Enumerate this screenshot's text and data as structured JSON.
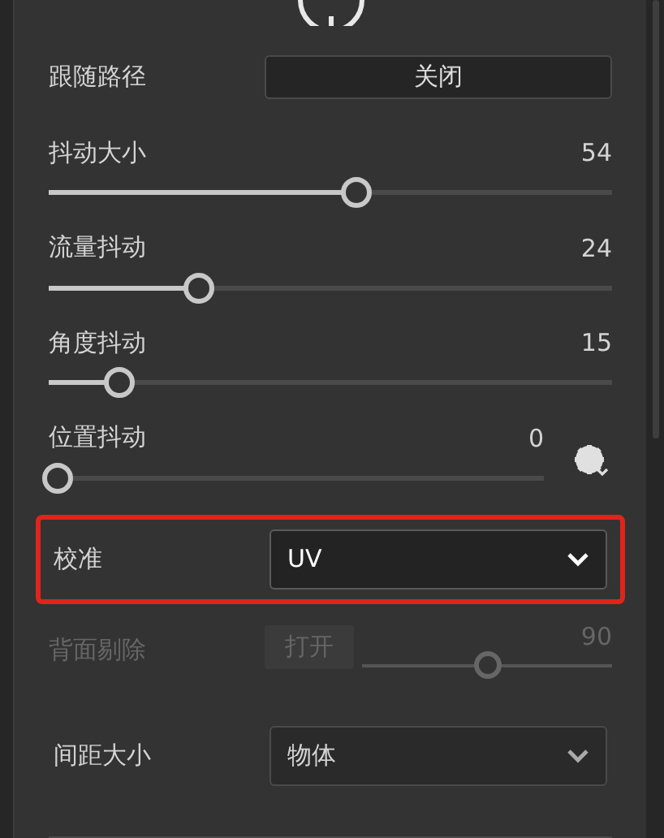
{
  "rows": [
    {
      "kind": "toggle",
      "label": "跟随路径",
      "button": "关闭"
    },
    {
      "kind": "slider",
      "label": "抖动大小",
      "value": "54",
      "level": 0.53
    },
    {
      "kind": "slider",
      "label": "流量抖动",
      "value": "24",
      "level": 0.25
    },
    {
      "kind": "slider",
      "label": "角度抖动",
      "value": "15",
      "level": 0.11
    },
    {
      "kind": "slider_settings",
      "label": "位置抖动",
      "value": "0",
      "level": 0
    },
    {
      "kind": "select",
      "label": "校准",
      "value": "UV",
      "highlighted": true,
      "emphasis": true
    },
    {
      "kind": "toggle_slider",
      "label": "背面剔除",
      "button": "打开",
      "value": "90",
      "level": 0.5,
      "disabled": true
    },
    {
      "kind": "select",
      "label": "间距大小",
      "value": "物体",
      "highlighted": false,
      "emphasis": false
    }
  ]
}
